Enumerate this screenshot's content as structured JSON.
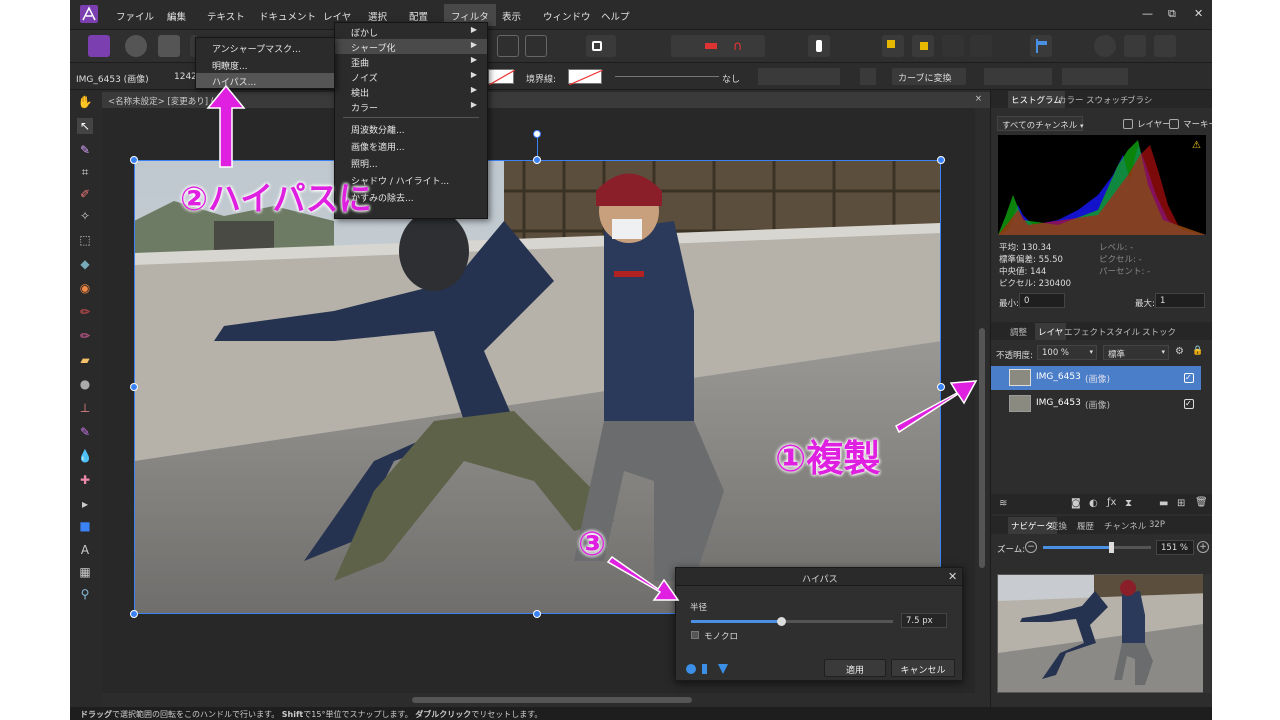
{
  "menubar": {
    "items": [
      "ファイル",
      "編集",
      "テキスト",
      "ドキュメント",
      "レイヤ",
      "選択",
      "配置",
      "フィルタ",
      "表示",
      "ウィンドウ",
      "ヘルプ"
    ],
    "active": "フィルタ",
    "window_controls": [
      "—",
      "⧉",
      "✕"
    ]
  },
  "context_bar": {
    "doc_name": "IMG_6453 (画像)",
    "doc_size": "1242",
    "border_label": "境界線:",
    "none_label": "なし",
    "convert_curve": "カーブに変換"
  },
  "document_tab": {
    "title": "<名称未設定> [変更あり] (1",
    "close": "×"
  },
  "filter_menu": {
    "items": [
      {
        "label": "ぼかし",
        "submenu": true
      },
      {
        "label": "シャープ化",
        "submenu": true,
        "highlighted": true
      },
      {
        "label": "歪曲",
        "submenu": true
      },
      {
        "label": "ノイズ",
        "submenu": true
      },
      {
        "label": "検出",
        "submenu": true
      },
      {
        "label": "カラー",
        "submenu": true
      },
      {
        "label": "周波数分離..."
      },
      {
        "label": "画像を適用..."
      },
      {
        "label": "照明..."
      },
      {
        "label": "シャドウ / ハイライト..."
      },
      {
        "label": "かすみの除去..."
      }
    ]
  },
  "sharpen_submenu": {
    "items": [
      {
        "label": "アンシャープマスク..."
      },
      {
        "label": "明瞭度..."
      },
      {
        "label": "ハイパス...",
        "highlighted": true
      }
    ]
  },
  "histogram_panel": {
    "tabs": [
      "ヒストグラム",
      "カラー",
      "スウォッチ",
      "ブラシ"
    ],
    "active_tab": "ヒストグラム",
    "channel": "すべてのチャンネル",
    "layer_check": "レイヤー",
    "marquee_check": "マーキー",
    "stats_left": [
      "平均: 130.34",
      "標準偏差: 55.50",
      "中央値: 144",
      "ピクセル: 230400"
    ],
    "stats_right": [
      "レベル: -",
      "ピクセル: -",
      "パーセント: -"
    ],
    "min_label": "最小:",
    "min_value": "0",
    "max_label": "最大:",
    "max_value": "1"
  },
  "layers_panel": {
    "tabs": [
      "調整",
      "レイヤ",
      "エフェクト",
      "スタイル",
      "ストック"
    ],
    "active_tab": "レイヤ",
    "opacity_label": "不透明度:",
    "opacity_value": "100 %",
    "blend_mode": "標準",
    "layers": [
      {
        "name": "IMG_6453",
        "kind": "(画像)",
        "selected": true,
        "visible": true
      },
      {
        "name": "IMG_6453",
        "kind": "(画像)",
        "selected": false,
        "visible": true
      }
    ]
  },
  "navigator_panel": {
    "tabs": [
      "ナビゲータ",
      "変換",
      "履歴",
      "チャンネル",
      "32P"
    ],
    "active_tab": "ナビゲータ",
    "zoom_label": "ズーム:",
    "zoom_value": "151 %",
    "zoom_slider": 0.63
  },
  "highpass_dialog": {
    "title": "ハイパス",
    "radius_label": "半径",
    "radius_value": "7.5 px",
    "radius_slider": 0.45,
    "mono_label": "モノクロ",
    "apply": "適用",
    "cancel": "キャンセル"
  },
  "status_bar": {
    "b1": "ドラッグ",
    "t1": "で選択範囲の回転をこのハンドルで行います。",
    "b2": "Shift",
    "t2": "で15°単位でスナップします。",
    "b3": "ダブルクリック",
    "t3": "でリセットします。"
  },
  "annotations": {
    "a1": "①複製",
    "a2": "②ハイパスに",
    "a3": "③",
    "color": "#e020e0"
  }
}
